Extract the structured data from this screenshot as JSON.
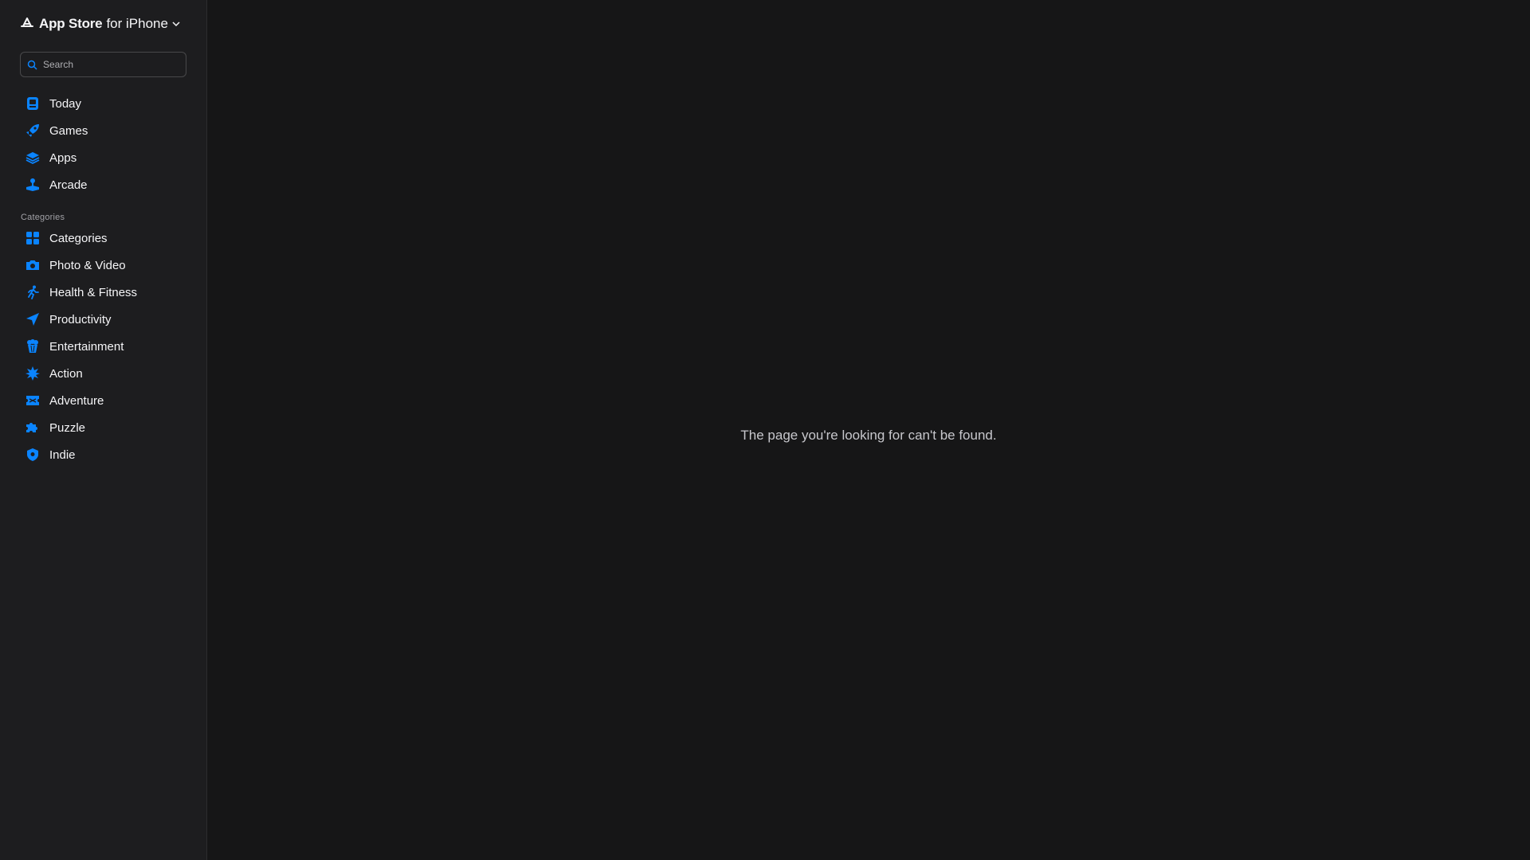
{
  "brand": {
    "name": "App Store",
    "suffix": "for iPhone"
  },
  "search": {
    "placeholder": "Search"
  },
  "nav": [
    {
      "label": "Today",
      "icon": "today-icon"
    },
    {
      "label": "Games",
      "icon": "rocket-icon"
    },
    {
      "label": "Apps",
      "icon": "stack-icon"
    },
    {
      "label": "Arcade",
      "icon": "joystick-icon"
    }
  ],
  "categories": {
    "title": "Categories",
    "items": [
      {
        "label": "Categories",
        "icon": "grid-icon"
      },
      {
        "label": "Photo & Video",
        "icon": "camera-icon"
      },
      {
        "label": "Health & Fitness",
        "icon": "runner-icon"
      },
      {
        "label": "Productivity",
        "icon": "paperplane-icon"
      },
      {
        "label": "Entertainment",
        "icon": "popcorn-icon"
      },
      {
        "label": "Action",
        "icon": "burst-icon"
      },
      {
        "label": "Adventure",
        "icon": "ticket-icon"
      },
      {
        "label": "Puzzle",
        "icon": "puzzle-icon"
      },
      {
        "label": "Indie",
        "icon": "shield-icon"
      }
    ]
  },
  "main": {
    "message": "The page you're looking for can't be found."
  },
  "colors": {
    "accent": "#0a84ff",
    "background": "#161617",
    "sidebar": "#1d1d1f"
  }
}
